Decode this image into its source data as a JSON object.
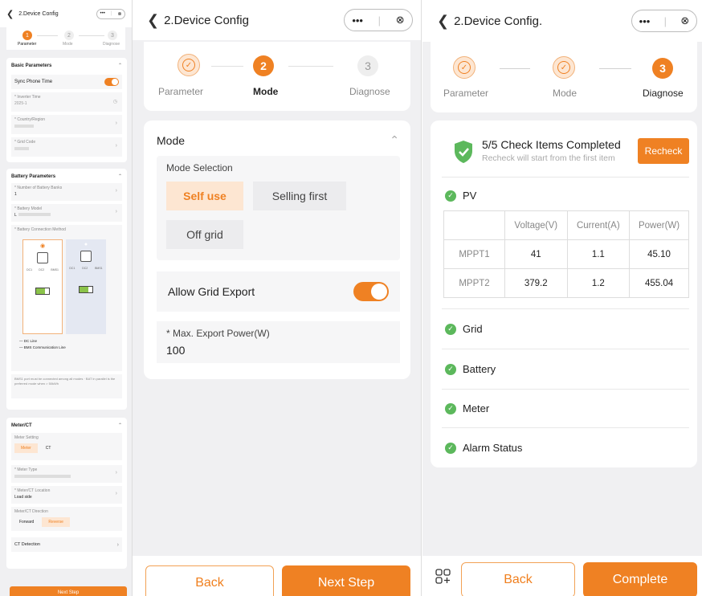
{
  "left": {
    "title": "2.Device Config",
    "steps": [
      {
        "num": "1",
        "label": "Parameter"
      },
      {
        "num": "2",
        "label": "Mode"
      },
      {
        "num": "3",
        "label": "Diagnose"
      }
    ],
    "basic": {
      "heading": "Basic Parameters",
      "sync_label": "Sync Phone Time",
      "inverter_time_label": "* Inverter Time",
      "inverter_time_value": "2025-1",
      "country_label": "* Country/Region",
      "grid_code_label": "* Grid Code"
    },
    "battery": {
      "heading": "Battery Parameters",
      "banks_label": "* Number of Battery Banks",
      "banks_value": "1",
      "model_label": "* Battery Model",
      "model_value": "L",
      "conn_label": "* Battery Connection Method",
      "legend_dc": "— DC Line",
      "legend_bms": "— BMS Communication Line",
      "port_labels": [
        "DC1",
        "DC2",
        "BMS1",
        "DC1",
        "DC2",
        "BMS1"
      ],
      "note": "BMS1 port must be connected among all modes · BAT in parallel is the preferred mode when > 50kWh"
    },
    "meter": {
      "heading": "Meter/CT",
      "setting_label": "Meter Setting",
      "opt_meter": "Meter",
      "opt_ct": "CT",
      "type_label": "* Meter Type",
      "loc_label": "* Meter/CT Location",
      "loc_value": "Load side",
      "dir_label": "Meter/CT Direction",
      "dir_forward": "Forward",
      "dir_reverse": "Reverse",
      "ct_detection": "CT Detection"
    },
    "next_btn": "Next Step"
  },
  "middle": {
    "title": "2.Device Config",
    "steps": [
      {
        "num": "",
        "label": "Parameter"
      },
      {
        "num": "2",
        "label": "Mode"
      },
      {
        "num": "3",
        "label": "Diagnose"
      }
    ],
    "mode_heading": "Mode",
    "mode_selection_label": "Mode Selection",
    "modes": [
      "Self use",
      "Selling first",
      "Off grid"
    ],
    "allow_export_label": "Allow Grid Export",
    "max_export_label": "* Max. Export Power(W)",
    "max_export_value": "100",
    "back_btn": "Back",
    "next_btn": "Next Step"
  },
  "right": {
    "title": "2.Device Config.",
    "steps": [
      {
        "num": "",
        "label": "Parameter"
      },
      {
        "num": "",
        "label": "Mode"
      },
      {
        "num": "3",
        "label": "Diagnose"
      }
    ],
    "summary_title": "5/5 Check Items Completed",
    "summary_sub": "Recheck will start from the first item",
    "recheck_btn": "Recheck",
    "pv_label": "PV",
    "table": {
      "headers": [
        "",
        "Voltage(V)",
        "Current(A)",
        "Power(W)"
      ],
      "rows": [
        [
          "MPPT1",
          "41",
          "1.1",
          "45.10"
        ],
        [
          "MPPT2",
          "379.2",
          "1.2",
          "455.04"
        ]
      ]
    },
    "items": [
      "Grid",
      "Battery",
      "Meter",
      "Alarm Status"
    ],
    "back_btn": "Back",
    "complete_btn": "Complete"
  },
  "colors": {
    "accent": "#ef8123",
    "green": "#5cb85c",
    "bg": "#f0f0f2"
  }
}
